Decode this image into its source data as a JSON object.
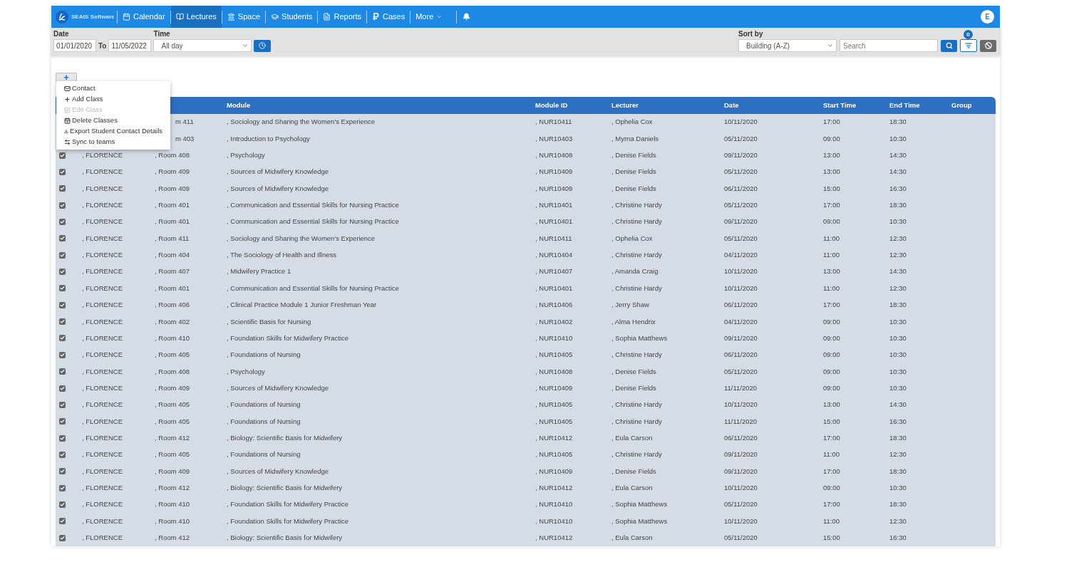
{
  "brand": {
    "name": "SEAtS Software"
  },
  "nav": [
    {
      "label": "Calendar",
      "selected": false
    },
    {
      "label": "Lectures",
      "selected": true
    },
    {
      "label": "Space",
      "selected": false
    },
    {
      "label": "Students",
      "selected": false
    },
    {
      "label": "Reports",
      "selected": false
    },
    {
      "label": "Cases",
      "selected": false
    },
    {
      "label": "More",
      "selected": false
    }
  ],
  "user": {
    "initial": "E"
  },
  "filters": {
    "date_label": "Date",
    "date_from": "01/01/2020",
    "to_label": "To",
    "date_to": "11/05/2022",
    "time_label": "Time",
    "time_value": "All day",
    "sort_label": "Sort by",
    "sort_value": "Building (A-Z)",
    "search_placeholder": "Search",
    "filter_count": "0"
  },
  "add_button": "+",
  "menu": [
    {
      "label": "Contact",
      "disabled": false
    },
    {
      "label": "Add Class",
      "disabled": false
    },
    {
      "label": "Edit Class",
      "disabled": true
    },
    {
      "label": "Delete Classes",
      "disabled": false
    },
    {
      "label": "Export Student Contact Details",
      "disabled": false
    },
    {
      "label": "Sync to teams",
      "disabled": false
    }
  ],
  "columns": [
    "Module",
    "Module ID",
    "Lecturer",
    "Date",
    "Start Time",
    "End Time",
    "Group"
  ],
  "rows": [
    {
      "partly_hidden": true,
      "room": "m 411",
      "module": ", Sociology and Sharing the Women's Experience",
      "module_id": ", NUR10411",
      "lecturer": ", Ophelia Cox",
      "date": "10/11/2020",
      "start": "17:00",
      "end": "18:30"
    },
    {
      "partly_hidden": true,
      "room": "m 403",
      "module": ", Introduction to Psychology",
      "module_id": ", NUR10403",
      "lecturer": ", Myrna Daniels",
      "date": "05/11/2020",
      "start": "09:00",
      "end": "10:30"
    },
    {
      "partly_hidden": false,
      "checked": true,
      "building": ", FLORENCE",
      "room": ", Room 408",
      "module": ", Psychology",
      "module_id": ", NUR10408",
      "lecturer": ", Denise Fields",
      "date": "09/11/2020",
      "start": "13:00",
      "end": "14:30"
    },
    {
      "partly_hidden": false,
      "checked": true,
      "building": ", FLORENCE",
      "room": ", Room 409",
      "module": ", Sources of Midwifery Knowledge",
      "module_id": ", NUR10409",
      "lecturer": ", Denise Fields",
      "date": "05/11/2020",
      "start": "13:00",
      "end": "14:30"
    },
    {
      "partly_hidden": false,
      "checked": true,
      "building": ", FLORENCE",
      "room": ", Room 409",
      "module": ", Sources of Midwifery Knowledge",
      "module_id": ", NUR10409",
      "lecturer": ", Denise Fields",
      "date": "06/11/2020",
      "start": "15:00",
      "end": "16:30"
    },
    {
      "partly_hidden": false,
      "checked": true,
      "building": ", FLORENCE",
      "room": ", Room 401",
      "module": ", Communication and Essential Skills for Nursing Practice",
      "module_id": ", NUR10401",
      "lecturer": ", Christine Hardy",
      "date": "05/11/2020",
      "start": "17:00",
      "end": "18:30"
    },
    {
      "partly_hidden": false,
      "checked": true,
      "building": ", FLORENCE",
      "room": ", Room 401",
      "module": ", Communication and Essential Skills for Nursing Practice",
      "module_id": ", NUR10401",
      "lecturer": ", Christine Hardy",
      "date": "09/11/2020",
      "start": "09:00",
      "end": "10:30"
    },
    {
      "partly_hidden": false,
      "checked": true,
      "building": ", FLORENCE",
      "room": ", Room 411",
      "module": ", Sociology and Sharing the Women's Experience",
      "module_id": ", NUR10411",
      "lecturer": ", Ophelia Cox",
      "date": "05/11/2020",
      "start": "11:00",
      "end": "12:30"
    },
    {
      "partly_hidden": false,
      "checked": true,
      "building": ", FLORENCE",
      "room": ", Room 404",
      "module": ", The Sociology of Health and Illness",
      "module_id": ", NUR10404",
      "lecturer": ", Christine Hardy",
      "date": "04/11/2020",
      "start": "11:00",
      "end": "12:30"
    },
    {
      "partly_hidden": false,
      "checked": true,
      "building": ", FLORENCE",
      "room": ", Room 407",
      "module": ", Midwifery Practice 1",
      "module_id": ", NUR10407",
      "lecturer": ", Amanda Craig",
      "date": "10/11/2020",
      "start": "13:00",
      "end": "14:30"
    },
    {
      "partly_hidden": false,
      "checked": true,
      "building": ", FLORENCE",
      "room": ", Room 401",
      "module": ", Communication and Essential Skills for Nursing Practice",
      "module_id": ", NUR10401",
      "lecturer": ", Christine Hardy",
      "date": "10/11/2020",
      "start": "11:00",
      "end": "12:30"
    },
    {
      "partly_hidden": false,
      "checked": true,
      "building": ", FLORENCE",
      "room": ", Room 406",
      "module": ", Clinical Practice Module 1 Junior Freshman Year",
      "module_id": ", NUR10406",
      "lecturer": ", Jerry Shaw",
      "date": "06/11/2020",
      "start": "17:00",
      "end": "18:30"
    },
    {
      "partly_hidden": false,
      "checked": true,
      "building": ", FLORENCE",
      "room": ", Room 402",
      "module": ", Scientific Basis for Nursing",
      "module_id": ", NUR10402",
      "lecturer": ", Alma Hendrix",
      "date": "04/11/2020",
      "start": "09:00",
      "end": "10:30"
    },
    {
      "partly_hidden": false,
      "checked": true,
      "building": ", FLORENCE",
      "room": ", Room 410",
      "module": ", Foundation Skills for Midwifery Practice",
      "module_id": ", NUR10410",
      "lecturer": ", Sophia Matthews",
      "date": "09/11/2020",
      "start": "09:00",
      "end": "10:30"
    },
    {
      "partly_hidden": false,
      "checked": true,
      "building": ", FLORENCE",
      "room": ", Room 405",
      "module": ", Foundations of Nursing",
      "module_id": ", NUR10405",
      "lecturer": ", Christine Hardy",
      "date": "06/11/2020",
      "start": "09:00",
      "end": "10:30"
    },
    {
      "partly_hidden": false,
      "checked": true,
      "building": ", FLORENCE",
      "room": ", Room 408",
      "module": ", Psychology",
      "module_id": ", NUR10408",
      "lecturer": ", Denise Fields",
      "date": "05/11/2020",
      "start": "09:00",
      "end": "10:30"
    },
    {
      "partly_hidden": false,
      "checked": true,
      "building": ", FLORENCE",
      "room": ", Room 409",
      "module": ", Sources of Midwifery Knowledge",
      "module_id": ", NUR10409",
      "lecturer": ", Denise Fields",
      "date": "11/11/2020",
      "start": "09:00",
      "end": "10:30"
    },
    {
      "partly_hidden": false,
      "checked": true,
      "building": ", FLORENCE",
      "room": ", Room 405",
      "module": ", Foundations of Nursing",
      "module_id": ", NUR10405",
      "lecturer": ", Christine Hardy",
      "date": "10/11/2020",
      "start": "13:00",
      "end": "14:30"
    },
    {
      "partly_hidden": false,
      "checked": true,
      "building": ", FLORENCE",
      "room": ", Room 405",
      "module": ", Foundations of Nursing",
      "module_id": ", NUR10405",
      "lecturer": ", Christine Hardy",
      "date": "11/11/2020",
      "start": "15:00",
      "end": "16:30"
    },
    {
      "partly_hidden": false,
      "checked": true,
      "building": ", FLORENCE",
      "room": ", Room 412",
      "module": ", Biology: Scientific Basis for Midwifery",
      "module_id": ", NUR10412",
      "lecturer": ", Eula Carson",
      "date": "06/11/2020",
      "start": "17:00",
      "end": "18:30"
    },
    {
      "partly_hidden": false,
      "checked": true,
      "building": ", FLORENCE",
      "room": ", Room 405",
      "module": ", Foundations of Nursing",
      "module_id": ", NUR10405",
      "lecturer": ", Christine Hardy",
      "date": "09/11/2020",
      "start": "11:00",
      "end": "12:30"
    },
    {
      "partly_hidden": false,
      "checked": true,
      "building": ", FLORENCE",
      "room": ", Room 409",
      "module": ", Sources of Midwifery Knowledge",
      "module_id": ", NUR10409",
      "lecturer": ", Denise Fields",
      "date": "09/11/2020",
      "start": "17:00",
      "end": "18:30"
    },
    {
      "partly_hidden": false,
      "checked": true,
      "building": ", FLORENCE",
      "room": ", Room 412",
      "module": ", Biology: Scientific Basis for Midwifery",
      "module_id": ", NUR10412",
      "lecturer": ", Eula Carson",
      "date": "10/11/2020",
      "start": "09:00",
      "end": "10:30"
    },
    {
      "partly_hidden": false,
      "checked": true,
      "building": ", FLORENCE",
      "room": ", Room 410",
      "module": ", Foundation Skills for Midwifery Practice",
      "module_id": ", NUR10410",
      "lecturer": ", Sophia Matthews",
      "date": "05/11/2020",
      "start": "17:00",
      "end": "18:30"
    },
    {
      "partly_hidden": false,
      "checked": true,
      "building": ", FLORENCE",
      "room": ", Room 410",
      "module": ", Foundation Skills for Midwifery Practice",
      "module_id": ", NUR10410",
      "lecturer": ", Sophia Matthews",
      "date": "10/11/2020",
      "start": "11:00",
      "end": "12:30"
    },
    {
      "partly_hidden": false,
      "checked": true,
      "building": ", FLORENCE",
      "room": ", Room 412",
      "module": ", Biology: Scientific Basis for Midwifery",
      "module_id": ", NUR10412",
      "lecturer": ", Eula Carson",
      "date": "05/11/2020",
      "start": "15:00",
      "end": "16:30"
    }
  ]
}
